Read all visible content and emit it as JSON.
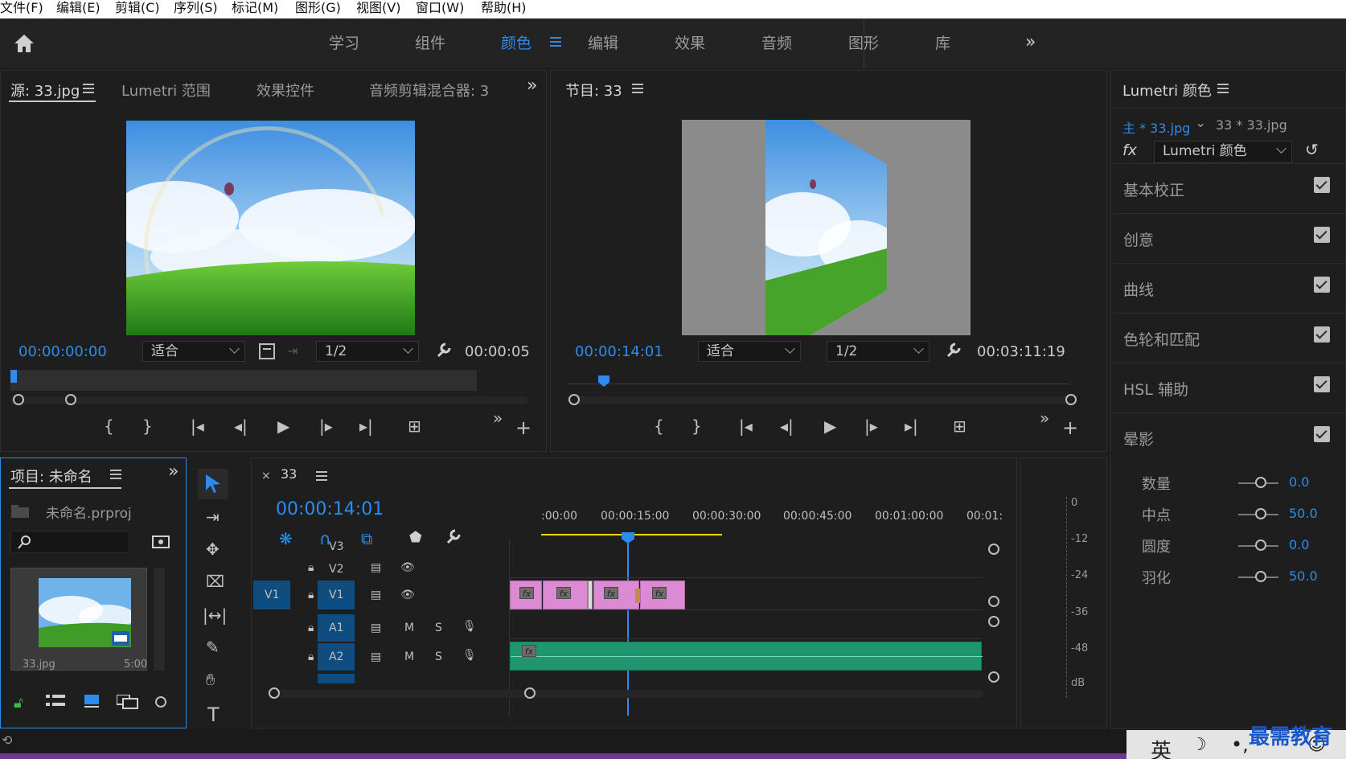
{
  "menu": [
    "文件(F)",
    "编辑(E)",
    "剪辑(C)",
    "序列(S)",
    "标记(M)",
    "图形(G)",
    "视图(V)",
    "窗口(W)",
    "帮助(H)"
  ],
  "workspaces": [
    "学习",
    "组件",
    "颜色",
    "编辑",
    "效果",
    "音频",
    "图形",
    "库"
  ],
  "active_workspace": "颜色",
  "source_panel": {
    "tabs": [
      "源: 33.jpg",
      "Lumetri 范围",
      "效果控件",
      "音频剪辑混合器: 3"
    ],
    "timecode": "00:00:00:00",
    "fit": "适合",
    "resolution": "1/2",
    "duration": "00:00:05"
  },
  "program_panel": {
    "tab": "节目: 33",
    "timecode": "00:00:14:01",
    "fit": "适合",
    "resolution": "1/2",
    "duration": "00:03:11:19"
  },
  "lumetri": {
    "title": "Lumetri 颜色",
    "clip_master": "主 * 33.jpg",
    "clip_seq": "33 * 33.jpg",
    "effect": "Lumetri 颜色",
    "sections": [
      "基本校正",
      "创意",
      "曲线",
      "色轮和匹配",
      "HSL 辅助",
      "晕影"
    ],
    "vignette": [
      {
        "label": "数量",
        "value": "0.0"
      },
      {
        "label": "中点",
        "value": "50.0"
      },
      {
        "label": "圆度",
        "value": "0.0"
      },
      {
        "label": "羽化",
        "value": "50.0"
      }
    ]
  },
  "project_panel": {
    "tab": "项目: 未命名",
    "file": "未命名.prproj",
    "thumb_name": "33.jpg",
    "thumb_dur": "5:00"
  },
  "timeline": {
    "tab": "33",
    "timecode": "00:00:14:01",
    "ruler": [
      ":00:00",
      "00:00:15:00",
      "00:00:30:00",
      "00:00:45:00",
      "00:01:00:00",
      "00:01:"
    ],
    "tracks": [
      "V3",
      "V2",
      "V1",
      "A1",
      "A2"
    ],
    "source_patch": "V1",
    "m": "M",
    "s": "S",
    "fx": "fx"
  },
  "meter": {
    "labels": [
      "0",
      "-12",
      "-24",
      "-36",
      "-48",
      "dB"
    ]
  },
  "ime": {
    "text": "英",
    "watermark": "最需教育"
  }
}
